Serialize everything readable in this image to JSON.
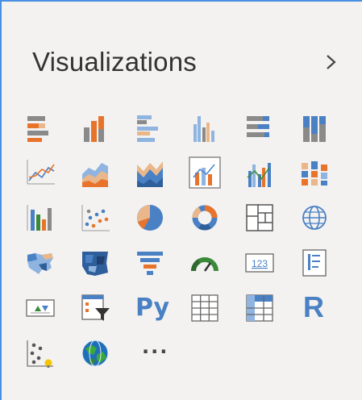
{
  "pane": {
    "title": "Visualizations",
    "collapse_icon": "chevron-right-icon"
  },
  "colors": {
    "orange": "#e8742c",
    "blue": "#4a80c4",
    "lightblue": "#8fb4e0",
    "gray": "#8a8a8a",
    "green": "#3a8a3a",
    "tan": "#e9b78a"
  },
  "visuals": [
    {
      "name": "stacked-bar-chart-icon"
    },
    {
      "name": "stacked-column-chart-icon"
    },
    {
      "name": "clustered-bar-chart-icon"
    },
    {
      "name": "clustered-column-chart-icon"
    },
    {
      "name": "100-stacked-bar-chart-icon"
    },
    {
      "name": "100-stacked-column-chart-icon"
    },
    {
      "name": "line-chart-icon"
    },
    {
      "name": "area-chart-icon"
    },
    {
      "name": "stacked-area-chart-icon"
    },
    {
      "name": "line-and-stacked-column-chart-icon"
    },
    {
      "name": "line-and-clustered-column-chart-icon"
    },
    {
      "name": "ribbon-chart-icon"
    },
    {
      "name": "waterfall-chart-icon"
    },
    {
      "name": "scatter-chart-icon"
    },
    {
      "name": "pie-chart-icon"
    },
    {
      "name": "donut-chart-icon"
    },
    {
      "name": "treemap-icon"
    },
    {
      "name": "map-icon"
    },
    {
      "name": "filled-map-icon"
    },
    {
      "name": "shape-map-icon"
    },
    {
      "name": "funnel-icon"
    },
    {
      "name": "gauge-icon"
    },
    {
      "name": "card-icon",
      "text": "123"
    },
    {
      "name": "multi-row-card-icon"
    },
    {
      "name": "kpi-icon"
    },
    {
      "name": "slicer-icon"
    },
    {
      "name": "python-visual-icon",
      "text": "Py"
    },
    {
      "name": "table-icon"
    },
    {
      "name": "matrix-icon"
    },
    {
      "name": "r-script-visual-icon",
      "text": "R"
    },
    {
      "name": "key-influencers-icon"
    },
    {
      "name": "arcgis-map-icon"
    },
    {
      "name": "more-visuals-icon",
      "text": "···"
    }
  ]
}
